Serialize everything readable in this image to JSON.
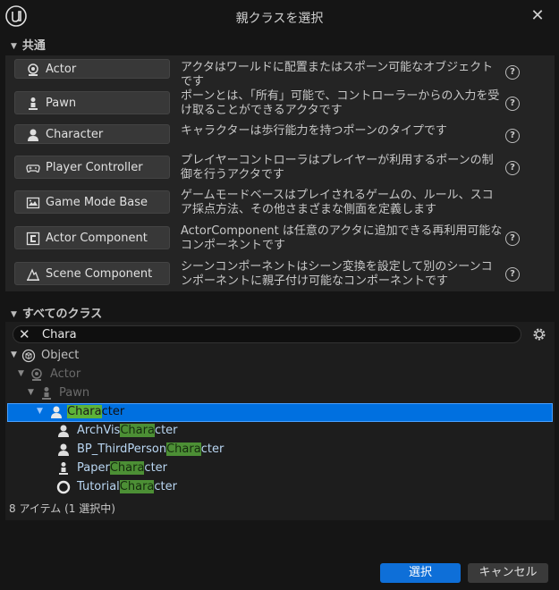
{
  "window": {
    "title": "親クラスを選択",
    "close_label": "✕"
  },
  "common": {
    "header": "共通",
    "classes": [
      {
        "name": "Actor",
        "icon": "actor-icon",
        "desc": "アクタはワールドに配置またはスポーン可能なオブジェクトです"
      },
      {
        "name": "Pawn",
        "icon": "pawn-icon",
        "desc": "ポーンとは、「所有」可能で、コントローラーからの入力を受け取ることができるアクタです"
      },
      {
        "name": "Character",
        "icon": "character-icon",
        "desc": "キャラクターは歩行能力を持つポーンのタイプです"
      },
      {
        "name": "Player Controller",
        "icon": "gamepad-icon",
        "desc": "プレイヤーコントローラはプレイヤーが利用するポーンの制御を行うアクタです"
      },
      {
        "name": "Game Mode Base",
        "icon": "game-mode-icon",
        "desc": "ゲームモードベースはプレイされるゲームの、ルール、スコア採点方法、その他さまざまな側面を定義します"
      },
      {
        "name": "Actor Component",
        "icon": "component-icon",
        "desc": "ActorComponent は任意のアクタに追加できる再利用可能なコンポーネントです"
      },
      {
        "name": "Scene Component",
        "icon": "scene-component-icon",
        "desc": "シーンコンポーネントはシーン変換を設定して別のシーンコンポーネントに親子付け可能なコンポーネントです"
      }
    ],
    "help_label": "?"
  },
  "all_classes": {
    "header": "すべてのクラス",
    "search_value": "Chara",
    "tree": {
      "object": "Object",
      "actor": "Actor",
      "pawn": "Pawn",
      "character": {
        "match": "Chara",
        "rest": "cter"
      },
      "children": [
        {
          "prefix": "ArchVis",
          "match": "Chara",
          "rest": "cter"
        },
        {
          "prefix": "BP_ThirdPerson",
          "match": "Chara",
          "rest": "cter"
        },
        {
          "prefix": "Paper",
          "match": "Chara",
          "rest": "cter"
        },
        {
          "prefix": "Tutorial",
          "match": "Chara",
          "rest": "cter"
        }
      ]
    },
    "status": "8 アイテム (1 選択中)"
  },
  "footer": {
    "select_label": "選択",
    "cancel_label": "キャンセル"
  },
  "colors": {
    "accent": "#0e6fd8",
    "match_highlight": "#5db339",
    "selected_row": "#0070e0"
  }
}
